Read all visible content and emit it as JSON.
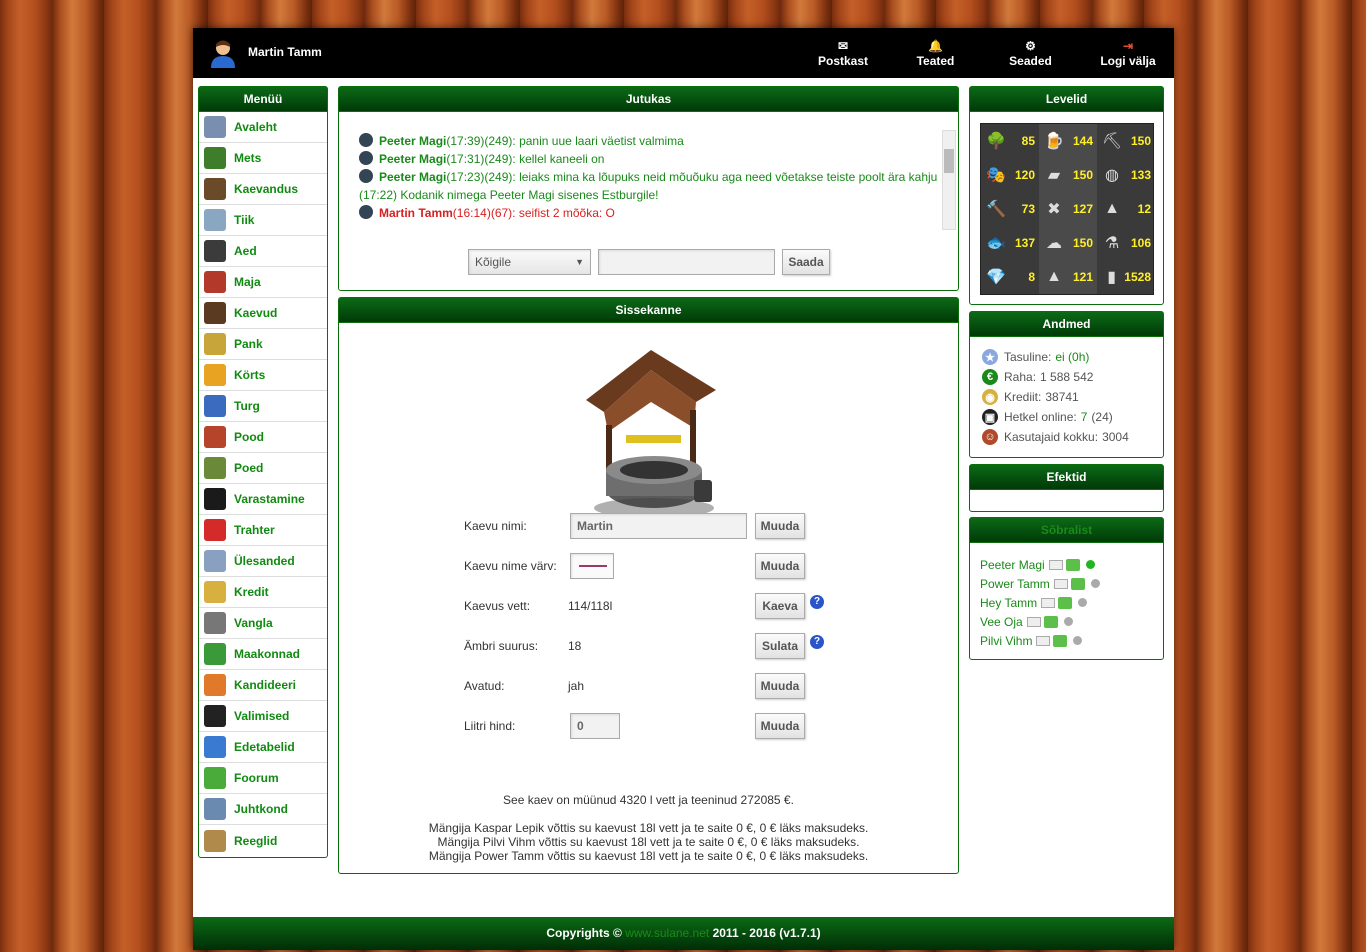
{
  "header": {
    "user_name": "Martin Tamm",
    "nav": [
      {
        "label": "Postkast",
        "icon": "envelope-icon"
      },
      {
        "label": "Teated",
        "icon": "bell-icon"
      },
      {
        "label": "Seaded",
        "icon": "gear-icon"
      },
      {
        "label": "Logi välja",
        "icon": "logout-icon"
      }
    ]
  },
  "menu": {
    "title": "Menüü",
    "items": [
      {
        "label": "Avaleht",
        "icon": "news-icon",
        "color": "#7a8fb0"
      },
      {
        "label": "Mets",
        "icon": "tree-icon",
        "color": "#3e7d2a"
      },
      {
        "label": "Kaevandus",
        "icon": "pickaxe-icon",
        "color": "#6b4a2a"
      },
      {
        "label": "Tiik",
        "icon": "fish-icon",
        "color": "#8aa7c2"
      },
      {
        "label": "Aed",
        "icon": "watering-can-icon",
        "color": "#3b3b3b"
      },
      {
        "label": "Maja",
        "icon": "house-icon",
        "color": "#b33a2a"
      },
      {
        "label": "Kaevud",
        "icon": "well-icon",
        "color": "#5a3a20"
      },
      {
        "label": "Pank",
        "icon": "bank-icon",
        "color": "#c8a53a"
      },
      {
        "label": "Körts",
        "icon": "beer-icon",
        "color": "#e7a321"
      },
      {
        "label": "Turg",
        "icon": "market-icon",
        "color": "#3a6bbf"
      },
      {
        "label": "Pood",
        "icon": "shop-icon",
        "color": "#b5442a"
      },
      {
        "label": "Poed",
        "icon": "shops-icon",
        "color": "#6a8a3a"
      },
      {
        "label": "Varastamine",
        "icon": "thief-icon",
        "color": "#1a1a1a"
      },
      {
        "label": "Trahter",
        "icon": "dice-icon",
        "color": "#d42a2a"
      },
      {
        "label": "Ülesanded",
        "icon": "magnifier-icon",
        "color": "#8aa0c0"
      },
      {
        "label": "Kredit",
        "icon": "coins-icon",
        "color": "#d7b040"
      },
      {
        "label": "Vangla",
        "icon": "jail-icon",
        "color": "#777777"
      },
      {
        "label": "Maakonnad",
        "icon": "globe-icon",
        "color": "#3a9a3a"
      },
      {
        "label": "Kandideeri",
        "icon": "apply-icon",
        "color": "#e07a2a"
      },
      {
        "label": "Valimised",
        "icon": "ballot-box-icon",
        "color": "#222222"
      },
      {
        "label": "Edetabelid",
        "icon": "bar-chart-icon",
        "color": "#3a7ad0"
      },
      {
        "label": "Foorum",
        "icon": "chat-bubble-icon",
        "color": "#4aaa3a"
      },
      {
        "label": "Juhtkond",
        "icon": "team-icon",
        "color": "#6a8ab0"
      },
      {
        "label": "Reeglid",
        "icon": "clipboard-icon",
        "color": "#b08a4a"
      }
    ]
  },
  "chat": {
    "title": "Jutukas",
    "lines": [
      {
        "type": "user",
        "who": "Peeter Magi",
        "meta": "(17:39)(249):",
        "msg": "panin uue laari väetist valmima"
      },
      {
        "type": "user",
        "who": "Peeter Magi",
        "meta": "(17:31)(249):",
        "msg": "kellel kaneeli on"
      },
      {
        "type": "user",
        "who": "Peeter Magi",
        "meta": "(17:23)(249):",
        "msg": "leiaks mina ka lõupuks neid mõuõuku aga need võetakse teiste poolt ära kahju"
      },
      {
        "type": "sys",
        "msg": "(17:22) Kodanik nimega Peeter Magi sisenes Estburgile!"
      },
      {
        "type": "red",
        "who": "Martin Tamm",
        "meta": "(16:14)(67):",
        "msg": "seifist 2 mõõka: O"
      }
    ],
    "target_select": "Kõigile",
    "message_value": "",
    "send_label": "Saada"
  },
  "entry": {
    "title": "Sissekanne",
    "rows": [
      {
        "label": "Kaevu nimi:",
        "value": "Martin",
        "button": "Muuda"
      },
      {
        "label": "Kaevu nime värv:",
        "value": "",
        "button": "Muuda"
      },
      {
        "label": "Kaevus vett:",
        "value": "114/118l",
        "button": "Kaeva",
        "help": "?"
      },
      {
        "label": "Ämbri suurus:",
        "value": "18",
        "button": "Sulata",
        "help": "?"
      },
      {
        "label": "Avatud:",
        "value": "jah",
        "button": "Muuda"
      },
      {
        "label": "Liitri hind:",
        "value": "0",
        "button": "Muuda"
      }
    ],
    "summary": "See kaev on müünud 4320 l vett ja teeninud 272085 €.",
    "log": [
      "Mängija Kaspar Lepik võttis su kaevust 18l vett ja te saite 0 €, 0 € läks maksudeks.",
      "Mängija Pilvi Vihm võttis su kaevust 18l vett ja te saite 0 €, 0 € läks maksudeks.",
      "Mängija Power Tamm võttis su kaevust 18l vett ja te saite 0 €, 0 € läks maksudeks."
    ]
  },
  "levels": {
    "title": "Levelid",
    "cells": [
      {
        "icon": "tree-icon",
        "value": "85"
      },
      {
        "icon": "beer-icon",
        "value": "144"
      },
      {
        "icon": "pickaxe-icon",
        "value": "150"
      },
      {
        "icon": "mask-icon",
        "value": "120"
      },
      {
        "icon": "gold-bar-icon",
        "value": "150"
      },
      {
        "icon": "watering-can-icon",
        "value": "133"
      },
      {
        "icon": "hammer-icon",
        "value": "73"
      },
      {
        "icon": "tools-icon",
        "value": "127"
      },
      {
        "icon": "anvil-icon",
        "value": "12"
      },
      {
        "icon": "fish-icon",
        "value": "137"
      },
      {
        "icon": "chef-hat-icon",
        "value": "150"
      },
      {
        "icon": "flask-icon",
        "value": "106"
      },
      {
        "icon": "diamond-icon",
        "value": "8"
      },
      {
        "icon": "witch-hat-icon",
        "value": "121"
      },
      {
        "icon": "bar-chart-icon",
        "value": "1528"
      }
    ]
  },
  "andmed": {
    "title": "Andmed",
    "rows": [
      {
        "label": "Tasuline:",
        "value": "ei (0h)",
        "icon": "star-icon"
      },
      {
        "label": "Raha:",
        "value": "1 588 542",
        "icon": "euro-icon"
      },
      {
        "label": "Krediit:",
        "value": "38741",
        "icon": "coins-icon"
      },
      {
        "label": "Hetkel online:",
        "value": "7",
        "value2": "(24)",
        "icon": "monitor-icon"
      },
      {
        "label": "Kasutajaid kokku:",
        "value": "3004",
        "icon": "users-icon"
      }
    ]
  },
  "efektid": {
    "title": "Efektid"
  },
  "friends": {
    "title": "Sõbralist",
    "items": [
      {
        "name": "Peeter Magi",
        "online": true
      },
      {
        "name": "Power Tamm",
        "online": false
      },
      {
        "name": "Hey Tamm",
        "online": false
      },
      {
        "name": "Vee Oja",
        "online": false
      },
      {
        "name": "Pilvi Vihm",
        "online": false
      }
    ]
  },
  "footer": {
    "prefix": "Copyrights ©",
    "link": "www.sulane.net",
    "suffix": "2011 - 2016 (v1.7.1)"
  },
  "colors": {
    "accent": "#0a6e0a",
    "link": "#1a8a1a",
    "level_value": "#ffef2a",
    "name_color_swatch": "#9a3a6a"
  }
}
